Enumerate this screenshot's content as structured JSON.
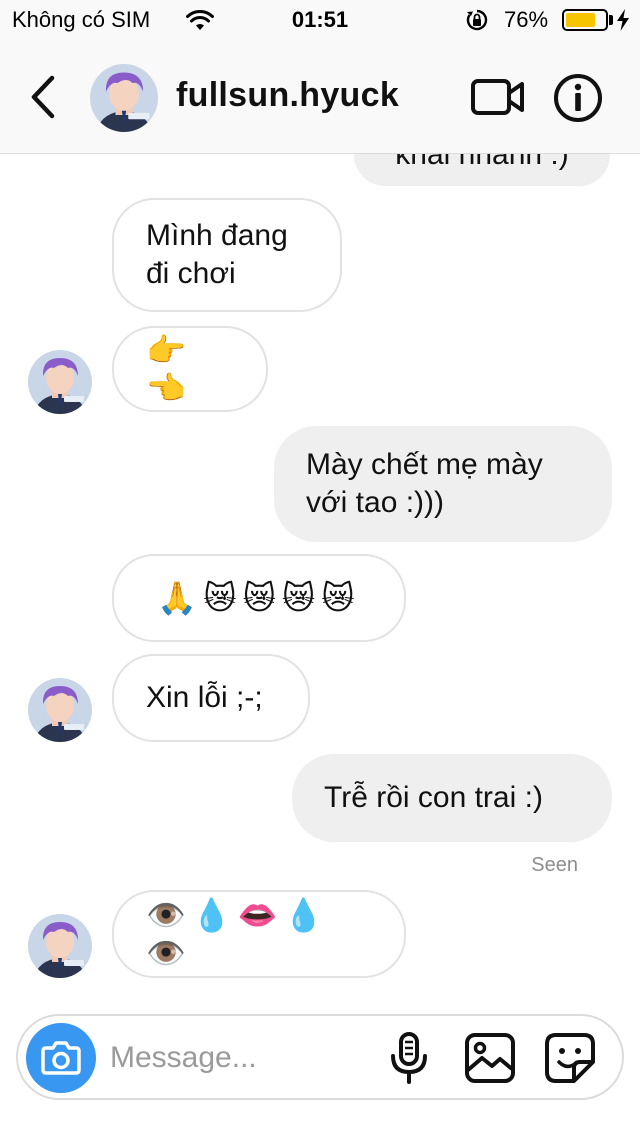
{
  "status_bar": {
    "carrier": "Không có SIM",
    "time": "01:51",
    "battery_percent": "76%",
    "battery_level": 0.76,
    "wifi_icon": "wifi-icon",
    "orientation_lock_icon": "orientation-lock-icon",
    "charging_icon": "charging-bolt-icon"
  },
  "header": {
    "back_icon": "chevron-left-icon",
    "username": "fullsun.hyuck",
    "video_icon": "video-camera-icon",
    "info_icon": "info-icon"
  },
  "messages": [
    {
      "direction": "out",
      "text": "khai nhanh :)",
      "clipped": true
    },
    {
      "direction": "in",
      "text": "Mình đang\nđi chơi",
      "avatar": false
    },
    {
      "direction": "in",
      "text": "👉👈",
      "avatar": true
    },
    {
      "direction": "out",
      "text": "Mày chết mẹ mày\nvới tao :)))"
    },
    {
      "direction": "in",
      "text": "🙏😿😿😿😿",
      "avatar": false
    },
    {
      "direction": "in",
      "text": "Xin lỗi ;-;",
      "avatar": true
    },
    {
      "direction": "out",
      "text": "Trễ rồi con trai :)"
    },
    {
      "direction": "in",
      "text": "👁️💧👄💧👁️",
      "avatar": true
    }
  ],
  "seen_label": "Seen",
  "composer": {
    "placeholder": "Message...",
    "camera_icon": "camera-icon",
    "mic_icon": "microphone-icon",
    "gallery_icon": "image-gallery-icon",
    "sticker_icon": "sticker-icon"
  },
  "colors": {
    "accent": "#3897f0",
    "battery": "#f7c400",
    "outgoing_bubble": "#efefef",
    "incoming_border": "#e2e2e2",
    "seen_text": "#8e8e8e"
  }
}
